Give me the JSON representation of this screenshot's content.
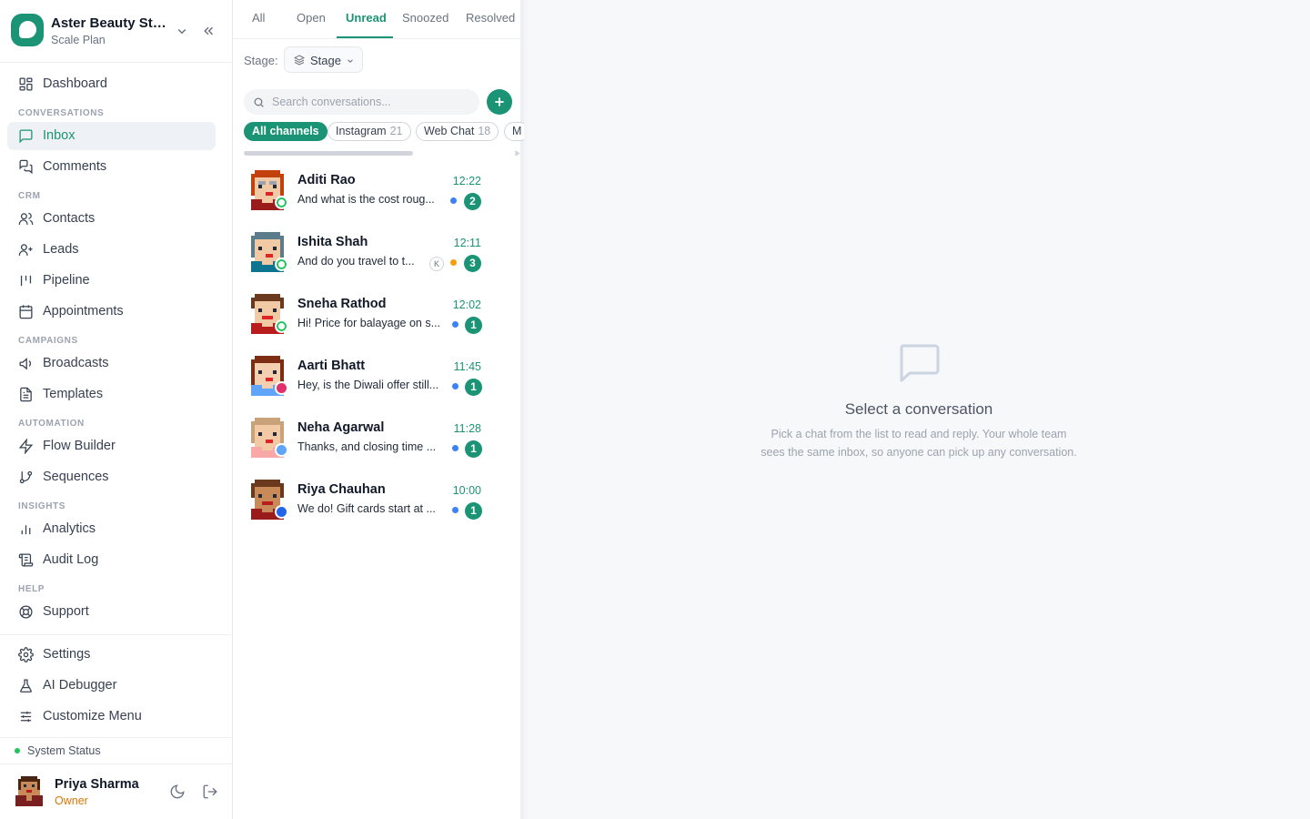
{
  "workspace": {
    "name": "Aster Beauty Stu...",
    "plan": "Scale Plan"
  },
  "nav": {
    "dashboard": "Dashboard",
    "sections": {
      "conversations": "CONVERSATIONS",
      "crm": "CRM",
      "campaigns": "CAMPAIGNS",
      "automation": "AUTOMATION",
      "insights": "INSIGHTS",
      "help": "HELP"
    },
    "inbox": "Inbox",
    "comments": "Comments",
    "contacts": "Contacts",
    "leads": "Leads",
    "pipeline": "Pipeline",
    "appointments": "Appointments",
    "broadcasts": "Broadcasts",
    "templates": "Templates",
    "flow_builder": "Flow Builder",
    "sequences": "Sequences",
    "analytics": "Analytics",
    "audit_log": "Audit Log",
    "support": "Support",
    "settings": "Settings",
    "ai_debugger": "AI Debugger",
    "customize_menu": "Customize Menu"
  },
  "system_status": "System Status",
  "user": {
    "name": "Priya Sharma",
    "role": "Owner"
  },
  "list": {
    "tabs": [
      "All",
      "Open",
      "Unread",
      "Snoozed",
      "Resolved"
    ],
    "active_tab": "Unread",
    "stage_label": "Stage:",
    "stage_button": "Stage",
    "search_placeholder": "Search conversations...",
    "channels": [
      {
        "label": "All channels",
        "count": ""
      },
      {
        "label": "Instagram",
        "count": "21"
      },
      {
        "label": "Web Chat",
        "count": "18"
      },
      {
        "label": "M",
        "count": ""
      }
    ],
    "conversations": [
      {
        "name": "Aditi Rao",
        "time": "12:22",
        "preview": "And what is the cost roug...",
        "count": "2"
      },
      {
        "name": "Ishita Shah",
        "time": "12:11",
        "preview": "And do you travel to t...",
        "count": "3",
        "assignee": "K"
      },
      {
        "name": "Sneha Rathod",
        "time": "12:02",
        "preview": "Hi! Price for balayage on s...",
        "count": "1"
      },
      {
        "name": "Aarti Bhatt",
        "time": "11:45",
        "preview": "Hey, is the Diwali offer still...",
        "count": "1"
      },
      {
        "name": "Neha Agarwal",
        "time": "11:28",
        "preview": "Thanks, and closing time ...",
        "count": "1"
      },
      {
        "name": "Riya Chauhan",
        "time": "10:00",
        "preview": "We do! Gift cards start at ...",
        "count": "1"
      }
    ]
  },
  "detail": {
    "title": "Select a conversation",
    "body": "Pick a chat from the list to read and reply. Your whole team sees the same inbox, so anyone can pick up any conversation."
  },
  "colors": {
    "accent": "#1a9474",
    "unread_blue": "#3b82f6",
    "unread_orange": "#f59e0b",
    "owner": "#d97706"
  }
}
